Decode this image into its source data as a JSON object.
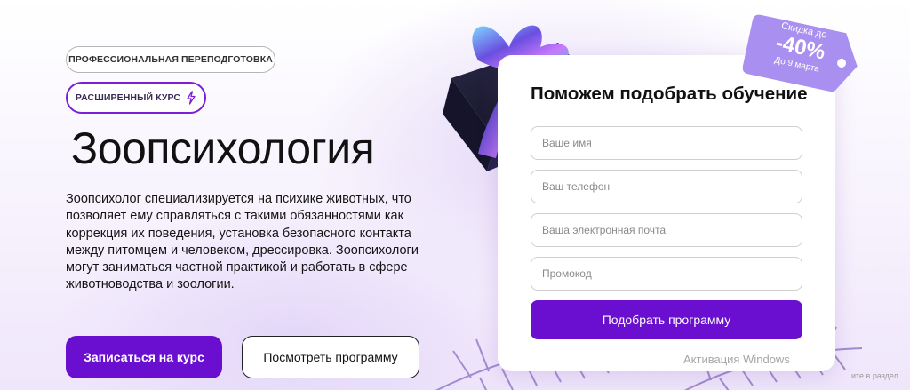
{
  "badges": {
    "retraining": "ПРОФЕССИОНАЛЬНАЯ ПЕРЕПОДГОТОВКА",
    "extended": "РАСШИРЕННЫЙ КУРС"
  },
  "hero": {
    "title": "Зоопсихология",
    "description": "Зоопсихолог специализируется на психике животных, что позволяет ему справляться с такими обязанностями как коррекция их поведения, установка безопасного контакта между питомцем и человеком, дрессировка. Зоопсихологи могут заниматься частной практикой и работать в сфере животноводства и зоологии.",
    "enroll_button": "Записаться на курс",
    "program_button": "Посмотреть программу"
  },
  "form": {
    "title": "Поможем подобрать обучение",
    "name_placeholder": "Ваше имя",
    "phone_placeholder": "Ваш телефон",
    "email_placeholder": "Ваша электронная почта",
    "promo_placeholder": "Промокод",
    "submit_button": "Подобрать программу"
  },
  "discount": {
    "top": "Скидка до",
    "value": "-40%",
    "bottom": "До 9 марта"
  },
  "watermark": {
    "title": "Активация Windows",
    "subtitle": "ите в раздел"
  },
  "colors": {
    "accent": "#6a0fcf",
    "discount_tag": "#a98ff0"
  },
  "icons": {
    "bolt": "lightning-bolt-icon",
    "gift": "gift-box-icon",
    "pine": "pine-branch-icon"
  }
}
